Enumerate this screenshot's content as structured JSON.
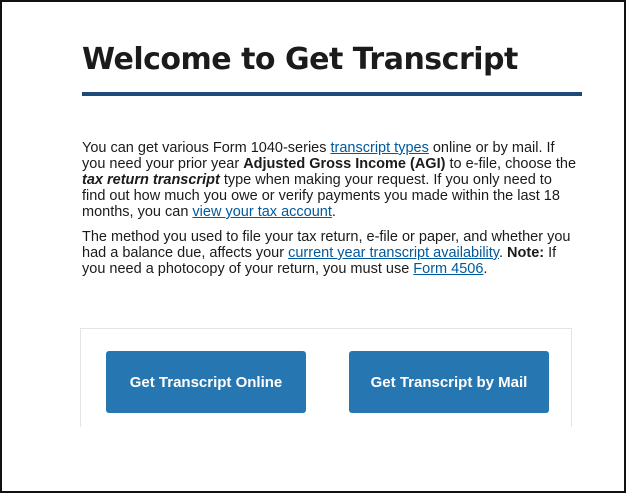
{
  "header": {
    "title": "Welcome to Get Transcript"
  },
  "content": {
    "paragraph1": {
      "t1": "You can get various Form 1040-series ",
      "link_transcript_types": "transcript types",
      "t2": " online or by mail. If you need your prior year ",
      "agi": "Adjusted Gross Income (AGI)",
      "t3": " to e-file, choose the ",
      "tax_return_transcript": "tax return transcript",
      "t4": " type when making your request. If you only need to find out how much you owe or verify payments you made within the last 18 months, you can ",
      "link_view_tax_account": "view your tax account",
      "t5": "."
    },
    "paragraph2": {
      "t1": "The method you used to file your tax return, e-file or paper, and whether you had a balance due, affects your ",
      "link_availability": "current year transcript availability",
      "t2": ". ",
      "note_label": "Note:",
      "t3": " If you need a photocopy of your return, you must use ",
      "link_form_4506": "Form 4506",
      "t4": "."
    }
  },
  "buttons": {
    "online_label": "Get Transcript Online",
    "mail_label": "Get Transcript by Mail"
  },
  "colors": {
    "accent_rule": "#1d4a7a",
    "button_bg": "#2677b1",
    "link": "#00599c"
  }
}
